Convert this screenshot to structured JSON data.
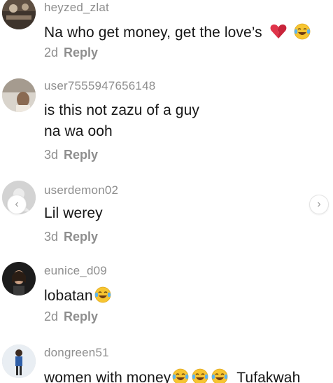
{
  "comments": [
    {
      "username": "heyzed_zlat",
      "text_lines": [
        "Na who get money, get the love’s"
      ],
      "emojis": [
        "broken-heart-icon",
        "tears-of-joy-icon"
      ],
      "time": "2d",
      "reply_label": "Reply"
    },
    {
      "username": "user7555947656148",
      "text_lines": [
        "is this not zazu of a guy",
        "na wa ooh"
      ],
      "time": "3d",
      "reply_label": "Reply"
    },
    {
      "username": "userdemon02",
      "text_lines": [
        "Lil werey"
      ],
      "time": "3d",
      "reply_label": "Reply"
    },
    {
      "username": "eunice_d09",
      "text_lines": [
        "lobatan"
      ],
      "emojis": [
        "tears-of-joy-icon"
      ],
      "time": "2d",
      "reply_label": "Reply"
    },
    {
      "username": "dongreen51",
      "text_lines": [
        "women with money",
        "Tufakwah"
      ],
      "emojis": [
        "tears-of-joy-icon",
        "tears-of-joy-icon",
        "tears-of-joy-icon"
      ]
    }
  ],
  "nav": {
    "prev_glyph": "‹",
    "next_glyph": "›"
  },
  "colors": {
    "text": "#161616",
    "muted": "#8e8e8e",
    "background": "#ffffff"
  }
}
